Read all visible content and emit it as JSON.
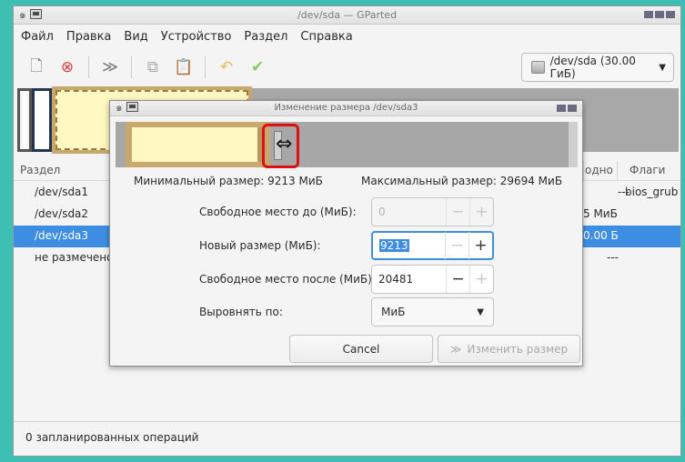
{
  "main_window": {
    "title": "/dev/sda — GParted",
    "menu": [
      "Файл",
      "Правка",
      "Вид",
      "Устройство",
      "Раздел",
      "Справка"
    ],
    "device_selector": "/dev/sda (30.00 ГиБ)",
    "columns": {
      "partition": "Раздел",
      "free": "одно",
      "flags": "Флаги"
    },
    "partitions": [
      {
        "name": "/dev/sda1",
        "free": "---",
        "flags": "bios_grub"
      },
      {
        "name": "/dev/sda2",
        "free": "5 МиБ",
        "flags": ""
      },
      {
        "name": "/dev/sda3",
        "free": "0.00 Б",
        "flags": ""
      },
      {
        "name": "не размечено",
        "free": "---",
        "flags": ""
      }
    ],
    "status": "0 запланированных операций"
  },
  "dialog": {
    "title": "Изменение размера /dev/sda3",
    "min_size": "Минимальный размер: 9213 МиБ",
    "max_size": "Максимальный размер: 29694 МиБ",
    "free_before_label": "Свободное место до (МиБ):",
    "free_before_value": "0",
    "new_size_label": "Новый размер (МиБ):",
    "new_size_value": "9213",
    "free_after_label": "Свободное место после (МиБ):",
    "free_after_value": "20481",
    "align_label": "Выровнять по:",
    "align_value": "МиБ",
    "cancel_label": "Cancel",
    "resize_label": "Изменить размер"
  }
}
